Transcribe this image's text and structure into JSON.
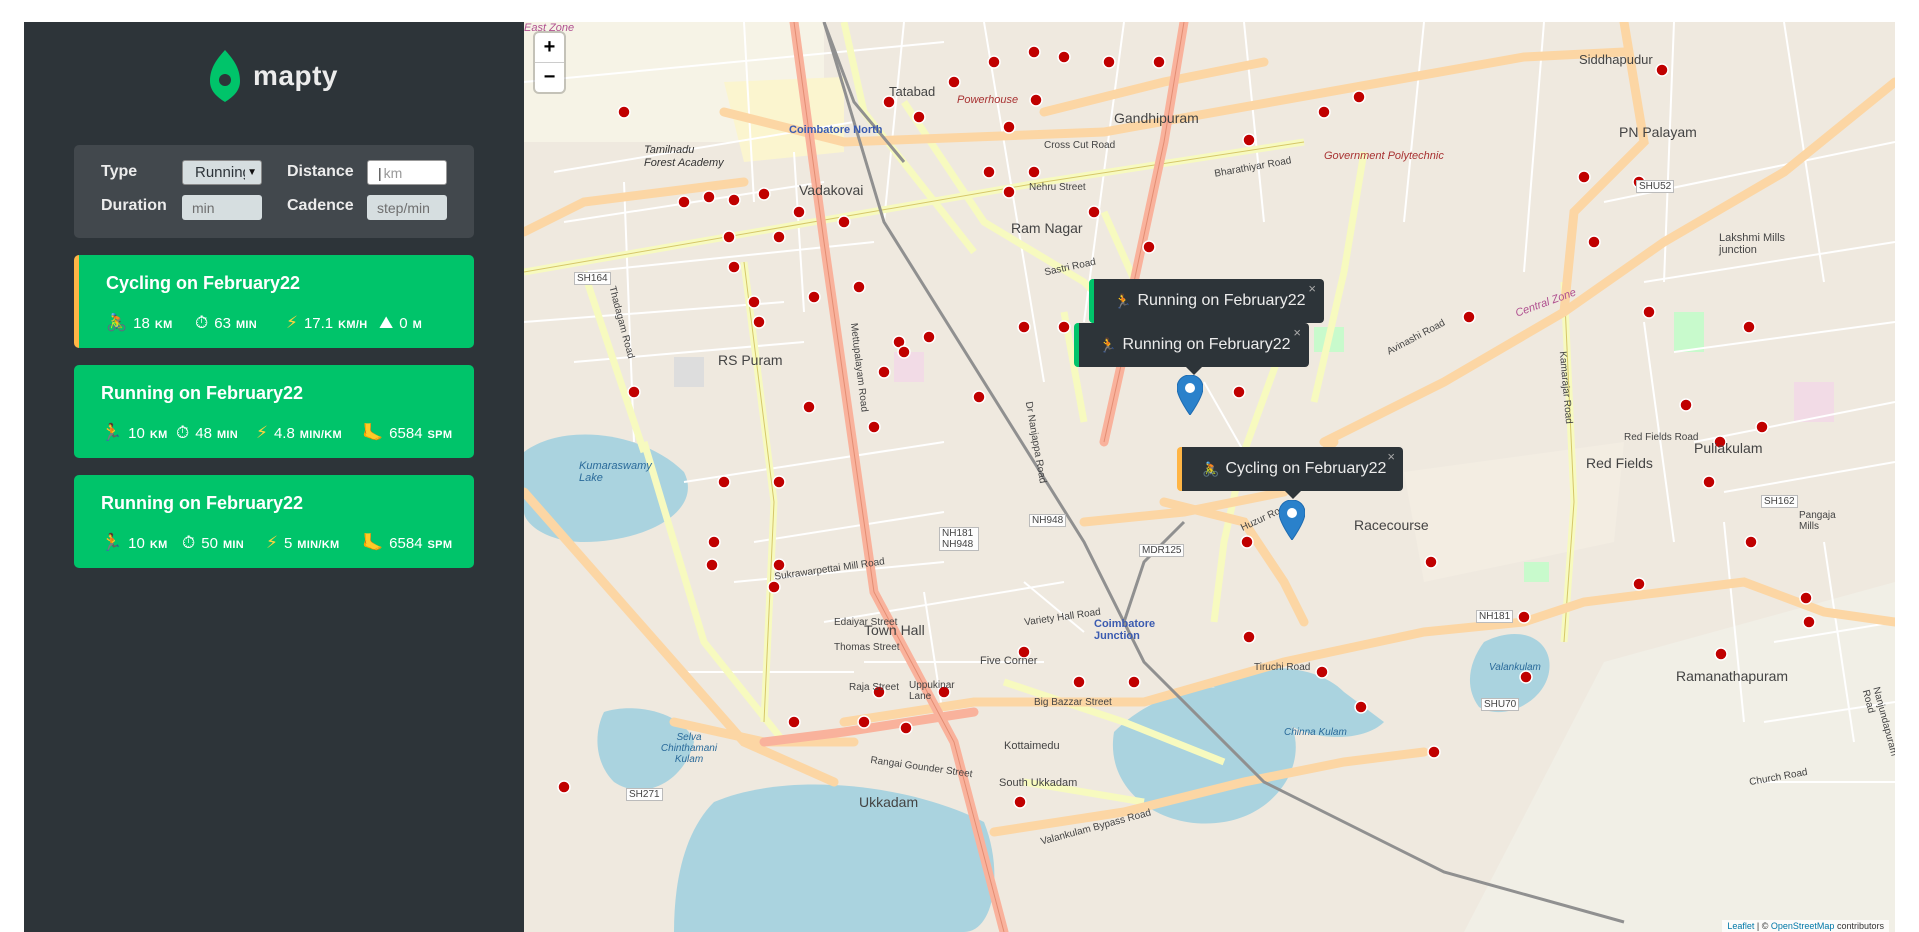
{
  "app": {
    "name": "mapty"
  },
  "form": {
    "type_label": "Type",
    "type_value": "Running",
    "distance_label": "Distance",
    "distance_placeholder": "km",
    "duration_label": "Duration",
    "duration_placeholder": "min",
    "cadence_label": "Cadence",
    "cadence_placeholder": "step/min"
  },
  "workouts": [
    {
      "type": "cycling",
      "title": "Cycling on February22",
      "distance": "18",
      "distance_unit": "KM",
      "duration": "63",
      "duration_unit": "MIN",
      "speed": "17.1",
      "speed_unit": "KM/H",
      "elevation": "0",
      "elevation_unit": "M"
    },
    {
      "type": "running",
      "title": "Running on February22",
      "distance": "10",
      "distance_unit": "KM",
      "duration": "48",
      "duration_unit": "MIN",
      "pace": "4.8",
      "pace_unit": "MIN/KM",
      "cadence": "6584",
      "cadence_unit": "SPM"
    },
    {
      "type": "running",
      "title": "Running on February22",
      "distance": "10",
      "distance_unit": "KM",
      "duration": "50",
      "duration_unit": "MIN",
      "pace": "5",
      "pace_unit": "MIN/KM",
      "cadence": "6584",
      "cadence_unit": "SPM"
    }
  ],
  "map": {
    "zoom_in": "+",
    "zoom_out": "−",
    "popups": [
      {
        "type": "running",
        "label": "Running on February22"
      },
      {
        "type": "running",
        "label": "Running on February22"
      },
      {
        "type": "cycling",
        "label": "Cycling on February22"
      }
    ],
    "close_glyph": "×",
    "attribution_leaflet": "Leaflet",
    "attribution_sep": "| ©",
    "attribution_osm": "OpenStreetMap",
    "attribution_tail": "contributors",
    "place_labels": [
      "Coimbatore North",
      "Tatabad",
      "Siddhapudur",
      "Gandhipuram",
      "Vadakovai",
      "Ram Nagar",
      "RS Puram",
      "Red Fields",
      "Racecourse",
      "Puliakulam",
      "Town Hall",
      "Ukkadam",
      "Ramanathapuram",
      "Coimbatore Junction",
      "Kumaraswamy Lake",
      "Tamilnadu Forest Academy",
      "PN Palayam",
      "Lakshmi Mills junction",
      "Five Corner",
      "Kottaimedu",
      "Government Polytechnic",
      "Powerhouse",
      "Cross Cut Road",
      "Avinashi Road",
      "Tiruchi Road",
      "Big Bazzar Street",
      "Valankulam Bypass Road",
      "Thadagam Road",
      "Mettupalayam Road",
      "Sastri Road",
      "Nehru Street",
      "Bharathiyar Road",
      "Raja Street",
      "Dr Nanjappa Road",
      "Huzur Road",
      "Sukrawarpettai Mill Road",
      "Variety Hall Road",
      "Selva Chinthamani Kulam",
      "Valankulam",
      "Chinna Kulam",
      "South Ukkadam",
      "Uppukinar Lane",
      "Edaiyar Street",
      "Thomas Street",
      "Rangai Gounder Street",
      "Kamarajar Road",
      "Central Zone",
      "East Zone",
      "Pangaja Mills",
      "Church Road",
      "Red Fields Road",
      "Nanjundapuram Road"
    ],
    "road_shields": [
      "SH164",
      "NH948",
      "NH181 NH948",
      "MDR125",
      "SHU52",
      "SH162",
      "NH181",
      "SHU70",
      "SH271"
    ]
  }
}
